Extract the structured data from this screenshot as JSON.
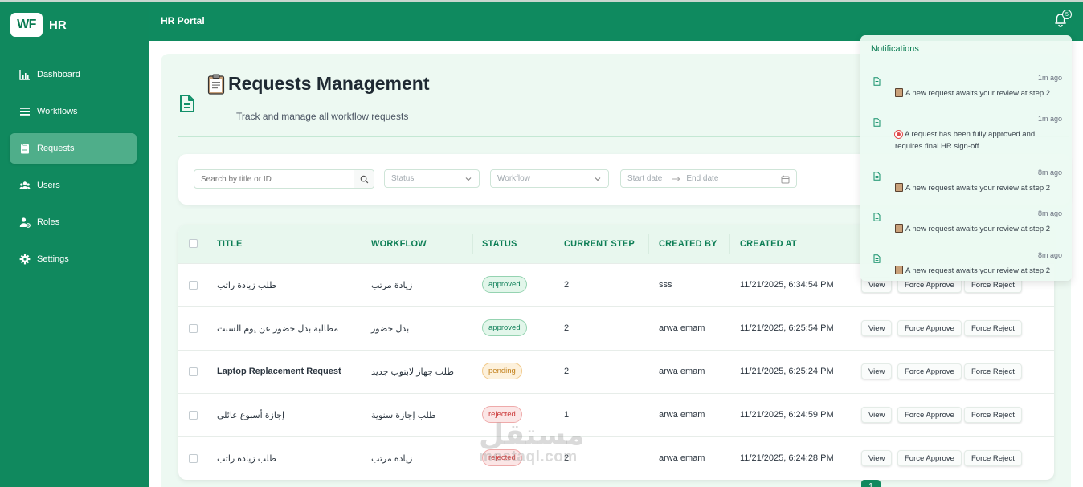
{
  "sidebar": {
    "logo": "WF",
    "brand": "HR",
    "items": [
      {
        "label": "Dashboard",
        "icon": "bar-chart-icon"
      },
      {
        "label": "Workflows",
        "icon": "list-icon"
      },
      {
        "label": "Requests",
        "icon": "clipboard-icon"
      },
      {
        "label": "Users",
        "icon": "users-icon"
      },
      {
        "label": "Roles",
        "icon": "user-role-icon"
      },
      {
        "label": "Settings",
        "icon": "gear-icon"
      }
    ]
  },
  "header": {
    "title": "HR Portal",
    "notification_count": "5"
  },
  "page": {
    "title": "Requests Management",
    "subtitle": "Track and manage all workflow requests"
  },
  "filters": {
    "search_placeholder": "Search by title or ID",
    "status_placeholder": "Status",
    "workflow_placeholder": "Workflow",
    "start_date_placeholder": "Start date",
    "end_date_placeholder": "End date"
  },
  "table": {
    "columns": [
      "TITLE",
      "WORKFLOW",
      "STATUS",
      "CURRENT STEP",
      "CREATED BY",
      "CREATED AT"
    ],
    "actions": {
      "view": "View",
      "approve": "Force Approve",
      "reject": "Force Reject"
    },
    "rows": [
      {
        "title": "طلب زيادة راتب",
        "workflow": "زيادة مرتب",
        "status": "approved",
        "step": "2",
        "created_by": "sss",
        "created_at": "11/21/2025, 6:34:54 PM"
      },
      {
        "title": "مطالبة بدل حضور عن يوم السبت",
        "workflow": "بدل حضور",
        "status": "approved",
        "step": "2",
        "created_by": "arwa emam",
        "created_at": "11/21/2025, 6:25:54 PM"
      },
      {
        "title": "Laptop Replacement Request",
        "workflow": "طلب جهاز لابتوب جديد",
        "status": "pending",
        "step": "2",
        "created_by": "arwa emam",
        "created_at": "11/21/2025, 6:25:24 PM"
      },
      {
        "title": "إجازة أسبوع عائلي",
        "workflow": "طلب إجازة سنوية",
        "status": "rejected",
        "step": "1",
        "created_by": "arwa emam",
        "created_at": "11/21/2025, 6:24:59 PM"
      },
      {
        "title": "طلب زيادة راتب",
        "workflow": "زيادة مرتب",
        "status": "rejected",
        "step": "2",
        "created_by": "arwa emam",
        "created_at": "11/21/2025, 6:24:28 PM"
      }
    ]
  },
  "pagination": {
    "current": "1"
  },
  "notifications": {
    "title": "Notifications",
    "items": [
      {
        "time": "1m ago",
        "message": "A new request awaits your review at step 2",
        "emoji": "clipboard"
      },
      {
        "time": "1m ago",
        "message": "A request has been fully approved and requires final HR sign-off",
        "emoji": "target"
      },
      {
        "time": "8m ago",
        "message": "A new request awaits your review at step 2",
        "emoji": "clipboard"
      },
      {
        "time": "8m ago",
        "message": "A new request awaits your review at step 2",
        "emoji": "clipboard"
      },
      {
        "time": "8m ago",
        "message": "A new request awaits your review at step 2",
        "emoji": "clipboard"
      }
    ]
  },
  "watermark": {
    "arabic": "مستقل",
    "latin": "mostaql.com"
  },
  "colors": {
    "primary": "#10895e",
    "approved": "#11805a",
    "pending": "#c2801b",
    "rejected": "#cc3b3b"
  }
}
